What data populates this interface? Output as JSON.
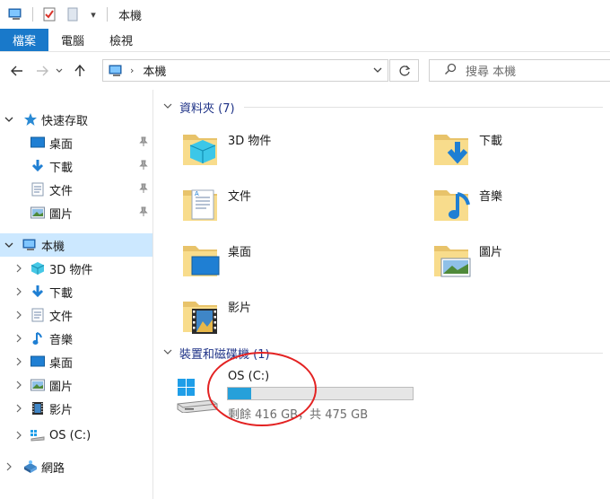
{
  "window": {
    "title": "本機"
  },
  "quick_access_toolbar": {
    "dropdown_glyph": "▾"
  },
  "ribbon": {
    "tabs": [
      "檔案",
      "電腦",
      "檢視"
    ],
    "active_tab": "檔案",
    "active_color": "#1979ca"
  },
  "address_bar": {
    "location": "本機",
    "separator": "›"
  },
  "search": {
    "placeholder": "搜尋 本機"
  },
  "nav_pane": {
    "quick_access": {
      "label": "快速存取",
      "items": [
        {
          "label": "桌面",
          "icon": "desktop-icon",
          "pinned": true
        },
        {
          "label": "下載",
          "icon": "downloads-icon",
          "pinned": true
        },
        {
          "label": "文件",
          "icon": "documents-icon",
          "pinned": true
        },
        {
          "label": "圖片",
          "icon": "pictures-icon",
          "pinned": true
        }
      ]
    },
    "this_pc": {
      "label": "本機",
      "selected": true,
      "items": [
        {
          "label": "3D 物件",
          "icon": "3d-objects-icon"
        },
        {
          "label": "下載",
          "icon": "downloads-icon"
        },
        {
          "label": "文件",
          "icon": "documents-icon"
        },
        {
          "label": "音樂",
          "icon": "music-icon"
        },
        {
          "label": "桌面",
          "icon": "desktop-icon"
        },
        {
          "label": "圖片",
          "icon": "pictures-icon"
        },
        {
          "label": "影片",
          "icon": "videos-icon"
        },
        {
          "label": "OS (C:)",
          "icon": "drive-icon"
        }
      ]
    },
    "network": {
      "label": "網路",
      "icon": "network-icon"
    }
  },
  "content": {
    "folders_group": {
      "title": "資料夾 (7)"
    },
    "folders": [
      {
        "label": "3D 物件",
        "icon": "3d-objects-folder-icon"
      },
      {
        "label": "下載",
        "icon": "downloads-folder-icon"
      },
      {
        "label": "文件",
        "icon": "documents-folder-icon"
      },
      {
        "label": "音樂",
        "icon": "music-folder-icon"
      },
      {
        "label": "桌面",
        "icon": "desktop-folder-icon"
      },
      {
        "label": "圖片",
        "icon": "pictures-folder-icon"
      },
      {
        "label": "影片",
        "icon": "videos-folder-icon"
      }
    ],
    "devices_group": {
      "title": "裝置和磁碟機 (1)"
    },
    "drive": {
      "name": "OS (C:)",
      "free_text": "剩餘 416 GB，共 475 GB",
      "used_fraction": 0.124,
      "bar_color": "#26a0da"
    }
  },
  "annotation": {
    "color": "#e32222",
    "shape": "ellipse"
  }
}
